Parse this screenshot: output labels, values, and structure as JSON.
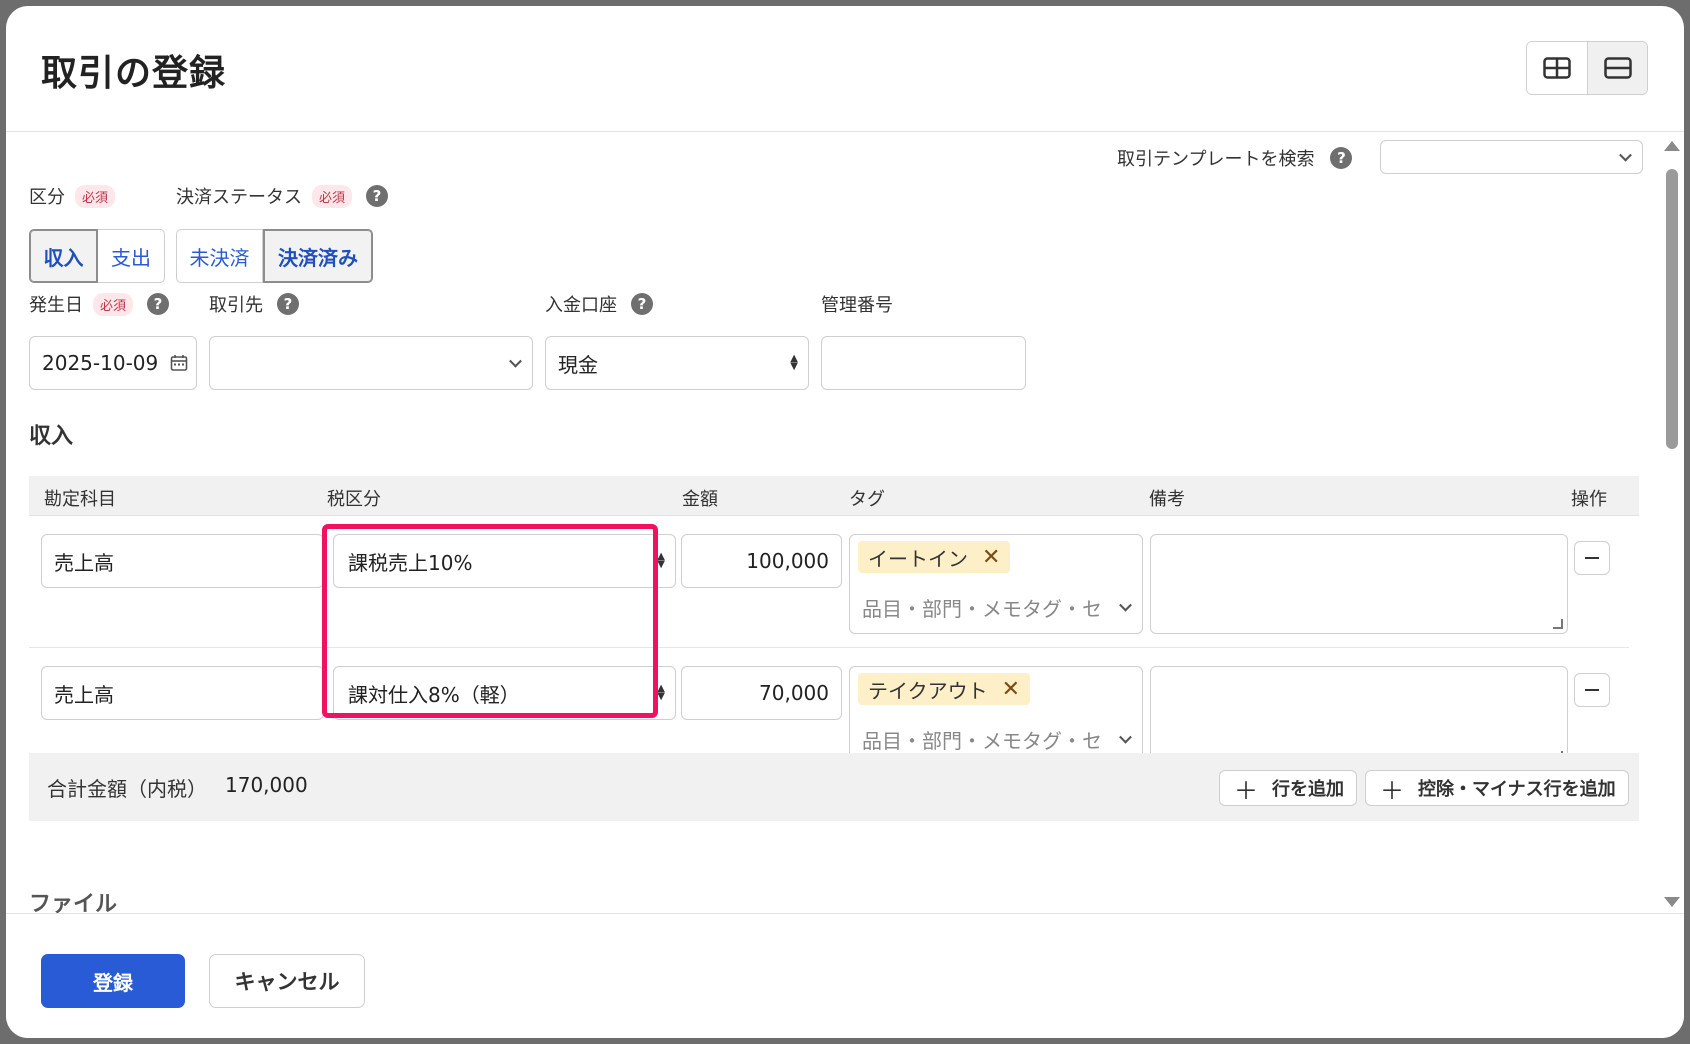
{
  "title": "取引の登録",
  "template_search": {
    "label": "取引テンプレートを検索",
    "value": ""
  },
  "kubun": {
    "label": "区分",
    "required": "必須",
    "options": [
      "収入",
      "支出"
    ],
    "selected": "収入"
  },
  "status": {
    "label": "決済ステータス",
    "required": "必須",
    "options": [
      "未決済",
      "決済済み"
    ],
    "selected": "決済済み"
  },
  "issue_date": {
    "label": "発生日",
    "required": "必須",
    "value": "2025-10-09"
  },
  "partner": {
    "label": "取引先",
    "value": ""
  },
  "account": {
    "label": "入金口座",
    "value": "現金"
  },
  "mgmt_no": {
    "label": "管理番号",
    "value": ""
  },
  "section_title": "収入",
  "table": {
    "headers": [
      "勘定科目",
      "税区分",
      "金額",
      "タグ",
      "備考",
      "操作"
    ],
    "rows": [
      {
        "account": "売上高",
        "tax": "課税売上10%",
        "amount": "100,000",
        "tag": "イートイン",
        "tag_placeholder": "品目・部門・メモタグ・セ",
        "memo": ""
      },
      {
        "account": "売上高",
        "tax": "課対仕入8%（軽）",
        "amount": "70,000",
        "tag": "テイクアウト",
        "tag_placeholder": "品目・部門・メモタグ・セ",
        "memo": ""
      }
    ]
  },
  "total": {
    "label": "合計金額（内税）",
    "value": "170,000"
  },
  "buttons": {
    "add_row": "行を追加",
    "add_minus_row": "控除・マイナス行を追加",
    "submit": "登録",
    "cancel": "キャンセル"
  },
  "file_section": "ファイル",
  "colors": {
    "primary": "#2a5bd7",
    "highlight": "#f0125f",
    "tag_bg": "#fdefc8",
    "required": "#c0354a"
  }
}
